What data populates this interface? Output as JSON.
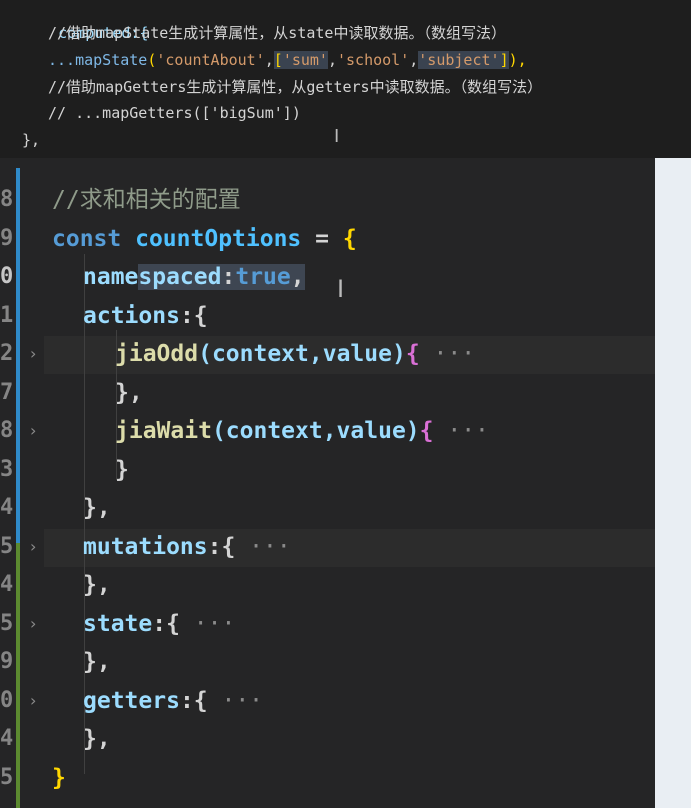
{
  "top_snippet": {
    "line1": "computed:{",
    "line2_comment": "//借助mapState生成计算属性，从state中读取数据。（数组写法）",
    "line3": {
      "spread": "...",
      "fn": "mapState",
      "open": "(",
      "arg1": "'countAbout'",
      "comma1": ",",
      "arr_open": "[",
      "s1": "'sum'",
      "c2": ",",
      "s2": "'school'",
      "c3": ",",
      "s3": "'subject'",
      "arr_close": "]",
      "close": "),"
    },
    "line4_comment": "//借助mapGetters生成计算属性，从getters中读取数据。（数组写法）",
    "line5_comment": "// ...mapGetters(['bigSum'])",
    "line6": "},"
  },
  "editor": {
    "line_numbers": [
      "8",
      "9",
      "0",
      "1",
      "2",
      "7",
      "8",
      "3",
      "4",
      "5",
      "4",
      "5",
      "9",
      "0",
      "4",
      "5"
    ],
    "lines": {
      "l1_comment": "//求和相关的配置",
      "l2_kw": "const",
      "l2_var": "countOptions",
      "l2_eq": " = ",
      "l2_brace": "{",
      "l3_prop_a": "name",
      "l3_prop_b": "spaced",
      "l3_colon": ":",
      "l3_val": "true",
      "l3_comma": ",",
      "l4_prop": "actions",
      "l4_rest": ":{",
      "l5_fn": "jiaOdd",
      "l5_args": "(context,value)",
      "l5_brace": "{",
      "l5_ell": " ···",
      "l6": "},",
      "l7_fn": "jiaWait",
      "l7_args": "(context,value)",
      "l7_brace": "{",
      "l7_ell": " ···",
      "l8": "}",
      "l9": "},",
      "l10_prop": "mutations",
      "l10_rest": ":{",
      "l10_ell": " ···",
      "l11": "},",
      "l12_prop": "state",
      "l12_rest": ":{",
      "l12_ell": " ···",
      "l13": "},",
      "l14_prop": "getters",
      "l14_rest": ":{",
      "l14_ell": " ···",
      "l15": "},",
      "l16": "}"
    },
    "fold_icon": "chevron-right",
    "cursor_icon": "i-beam",
    "colors": {
      "keyword": "#569cd6",
      "variable": "#4fc1ff",
      "property": "#9cdcfe",
      "function": "#dcdcaa",
      "comment": "#8f9b8a",
      "gutter_modified": "#2f8ac9",
      "gutter_added": "#5c8a30"
    }
  }
}
